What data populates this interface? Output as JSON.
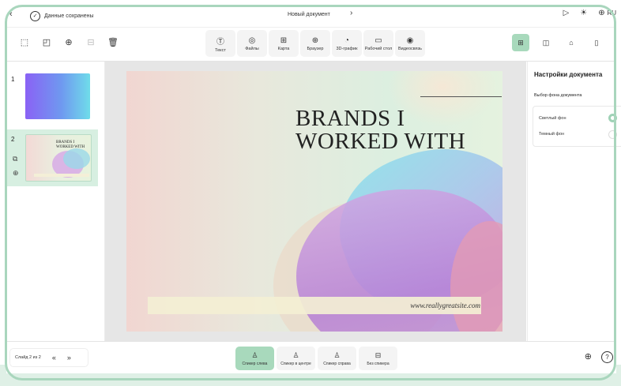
{
  "topbar": {
    "back_icon": "‹",
    "saved_icon": "✓",
    "saved_text": "Данные сохранены",
    "doc_title": "Новый документ",
    "chevron": "›",
    "play_icon": "▷",
    "theme_icon": "☀",
    "lang_icon": "⊕",
    "lang_label": "RU"
  },
  "toolbar": {
    "left_icons": [
      "⬚",
      "◰",
      "⊕",
      "⊟",
      "🗑"
    ],
    "center": [
      {
        "icon": "Ⓣ",
        "label": "Текст"
      },
      {
        "icon": "◎",
        "label": "Файлы"
      },
      {
        "icon": "⊞",
        "label": "Карта"
      },
      {
        "icon": "⊕",
        "label": "Браузер"
      },
      {
        "icon": "◔",
        "label": "3D-график"
      },
      {
        "icon": "▭",
        "label": "Рабочий стол"
      },
      {
        "icon": "◉",
        "label": "Видеосвязь"
      }
    ],
    "right_icons": [
      "⊞",
      "◫",
      "⌂",
      "▯"
    ]
  },
  "slides": [
    {
      "number": "1"
    },
    {
      "number": "2",
      "thumb_title": "BRANDS I WORKED WITH"
    }
  ],
  "slide_actions": {
    "duplicate_icon": "⧉",
    "add_icon": "⊕"
  },
  "slide": {
    "title": "BRANDS I WORKED WITH",
    "url": "www.reallygreatsite.com"
  },
  "settings": {
    "title": "Настройки документа",
    "subtitle": "Выбор фона документа",
    "options": [
      {
        "label": "Светлый фон",
        "selected": true
      },
      {
        "label": "Темный фон",
        "selected": false
      }
    ]
  },
  "bottombar": {
    "slide_counter": "Слайд 2 из 2",
    "prev": "«",
    "next": "»",
    "speaker_modes": [
      {
        "icon": "♙",
        "label": "Спикер слева",
        "active": true
      },
      {
        "icon": "♙",
        "label": "Спикер в центре",
        "active": false
      },
      {
        "icon": "♙",
        "label": "Спикер справа",
        "active": false
      },
      {
        "icon": "⊟",
        "label": "Без спикера",
        "active": false
      }
    ],
    "globe_icon": "⊕",
    "help_icon": "?"
  }
}
